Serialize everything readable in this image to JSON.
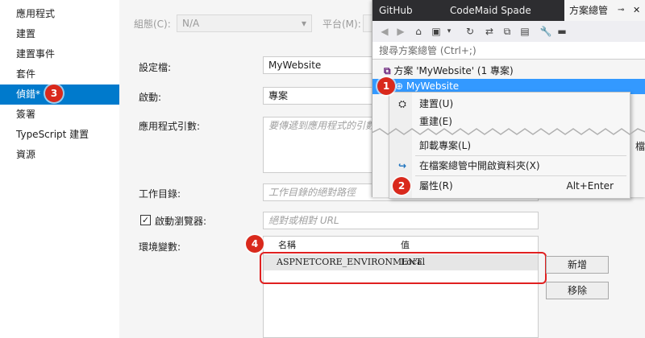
{
  "sidebar": {
    "items": [
      {
        "label": "應用程式"
      },
      {
        "label": "建置"
      },
      {
        "label": "建置事件"
      },
      {
        "label": "套件"
      },
      {
        "label": "偵錯*"
      },
      {
        "label": "簽署"
      },
      {
        "label": "TypeScript 建置"
      },
      {
        "label": "資源"
      }
    ],
    "active_index": 4
  },
  "top": {
    "config_label": "組態(C):",
    "config_value": "N/A",
    "platform_label": "平台(M):"
  },
  "form": {
    "profile_label": "設定檔:",
    "profile_value": "MyWebsite",
    "launch_label": "啟動:",
    "launch_value": "專案",
    "args_label": "應用程式引數:",
    "args_placeholder": "要傳遞到應用程式的引數",
    "workdir_label": "工作目錄:",
    "workdir_placeholder": "工作目錄的絕對路徑",
    "browser_label": "啟動瀏覽器:",
    "browser_checked": true,
    "browser_placeholder": "絕對或相對 URL",
    "env_label": "環境變數:",
    "env_headers": [
      "名稱",
      "值"
    ],
    "env_rows": [
      [
        "ASPNETCORE_ENVIRONMENT",
        "Local"
      ]
    ],
    "add_button": "新增",
    "remove_button": "移除"
  },
  "solution_explorer": {
    "tabs": [
      "GitHub",
      "CodeMaid Spade",
      "方案總管"
    ],
    "active_tab": "方案總管",
    "search_placeholder": "搜尋方案總管 (Ctrl+;)",
    "solution_label": "方案 'MyWebsite' (1 專案)",
    "project_label": "MyWebsite",
    "partial_text": "檔"
  },
  "context_menu": {
    "items": [
      {
        "label": "建置(U)",
        "icon": "build-icon",
        "shortcut": ""
      },
      {
        "label": "重建(E)",
        "icon": "",
        "shortcut": ""
      },
      {
        "label": "卸載專案(L)",
        "icon": "",
        "shortcut": ""
      },
      {
        "label": "在檔案總管中開啟資料夾(X)",
        "icon": "open-folder-arrow-icon",
        "shortcut": ""
      },
      {
        "label": "屬性(R)",
        "icon": "wrench-icon",
        "shortcut": "Alt+Enter"
      }
    ]
  },
  "callouts": [
    "1",
    "2",
    "3",
    "4"
  ],
  "colors": {
    "accent": "#007acc",
    "selection": "#3399ff",
    "callout": "#d9291c"
  }
}
